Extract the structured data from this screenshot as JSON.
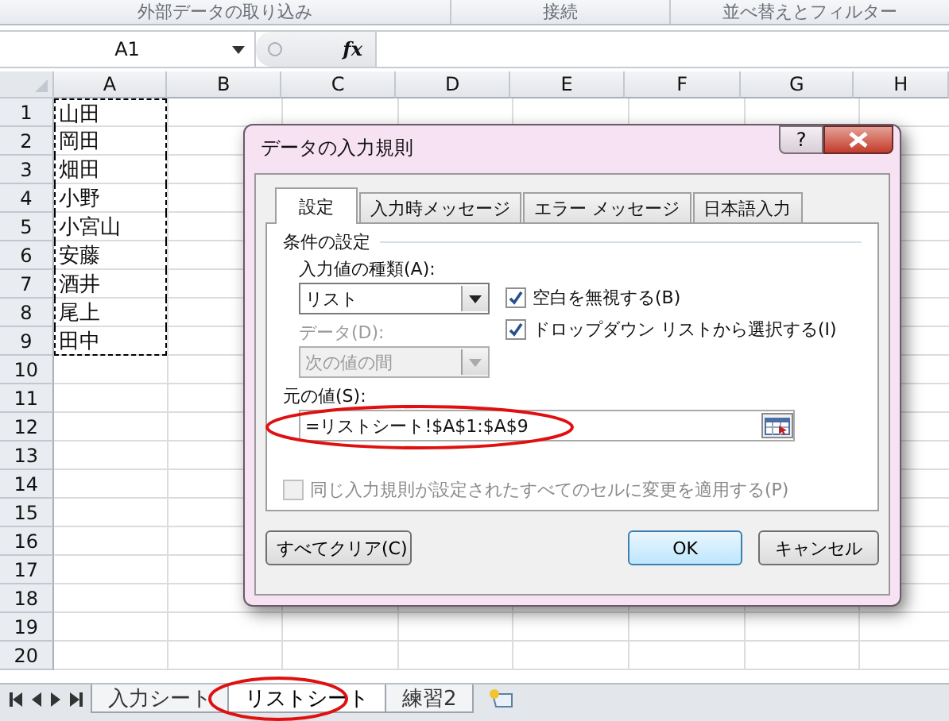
{
  "ribbon_groups": [
    {
      "label": "外部データの取り込み"
    },
    {
      "label": "接続"
    },
    {
      "label": "並べ替えとフィルター"
    }
  ],
  "name_box": {
    "value": "A1"
  },
  "formula_bar": {
    "fx": "fx"
  },
  "columns": [
    "A",
    "B",
    "C",
    "D",
    "E",
    "F",
    "G",
    "H"
  ],
  "rows": [
    {
      "number": "1",
      "a": "山田",
      "marked": true
    },
    {
      "number": "2",
      "a": "岡田",
      "marked": true
    },
    {
      "number": "3",
      "a": "畑田",
      "marked": true
    },
    {
      "number": "4",
      "a": "小野",
      "marked": true
    },
    {
      "number": "5",
      "a": "小宮山",
      "marked": true
    },
    {
      "number": "6",
      "a": "安藤",
      "marked": true
    },
    {
      "number": "7",
      "a": "酒井",
      "marked": true
    },
    {
      "number": "8",
      "a": "尾上",
      "marked": true
    },
    {
      "number": "9",
      "a": "田中",
      "marked": true
    },
    {
      "number": "10",
      "marked": false
    },
    {
      "number": "11",
      "marked": false
    },
    {
      "number": "12",
      "marked": false
    },
    {
      "number": "13",
      "marked": false
    },
    {
      "number": "14",
      "marked": false
    },
    {
      "number": "15",
      "marked": false
    },
    {
      "number": "16",
      "marked": false
    },
    {
      "number": "17",
      "marked": false
    },
    {
      "number": "18",
      "marked": false
    },
    {
      "number": "19",
      "marked": false
    },
    {
      "number": "20",
      "marked": false
    }
  ],
  "dialog": {
    "title": "データの入力規則",
    "help": "?",
    "tabs": [
      {
        "label": "設定",
        "selected": true
      },
      {
        "label": "入力時メッセージ",
        "selected": false
      },
      {
        "label": "エラー メッセージ",
        "selected": false
      },
      {
        "label": "日本語入力",
        "selected": false
      }
    ],
    "section": "条件の設定",
    "allow": {
      "label": "入力値の種類(A):",
      "value": "リスト",
      "disabled": false
    },
    "data": {
      "label": "データ(D):",
      "value": "次の値の間",
      "disabled": true
    },
    "checkboxes": [
      {
        "label": "空白を無視する(B)",
        "checked": true,
        "disabled": false
      },
      {
        "label": "ドロップダウン リストから選択する(I)",
        "checked": true,
        "disabled": false
      }
    ],
    "source": {
      "label": "元の値(S):",
      "value": "=リストシート!$A$1:$A$9"
    },
    "apply_all": {
      "label": "同じ入力規則が設定されたすべてのセルに変更を適用する(P)",
      "checked": false,
      "disabled": true
    },
    "buttons": [
      {
        "label": "すべてクリア(C)",
        "kind": "clear"
      },
      {
        "label": "OK",
        "kind": "default"
      },
      {
        "label": "キャンセル",
        "kind": "cancel"
      }
    ]
  },
  "sheet_tabs": [
    {
      "label": "入力シート",
      "selected": false
    },
    {
      "label": "リストシート",
      "selected": true
    },
    {
      "label": "練習2",
      "selected": false
    }
  ]
}
